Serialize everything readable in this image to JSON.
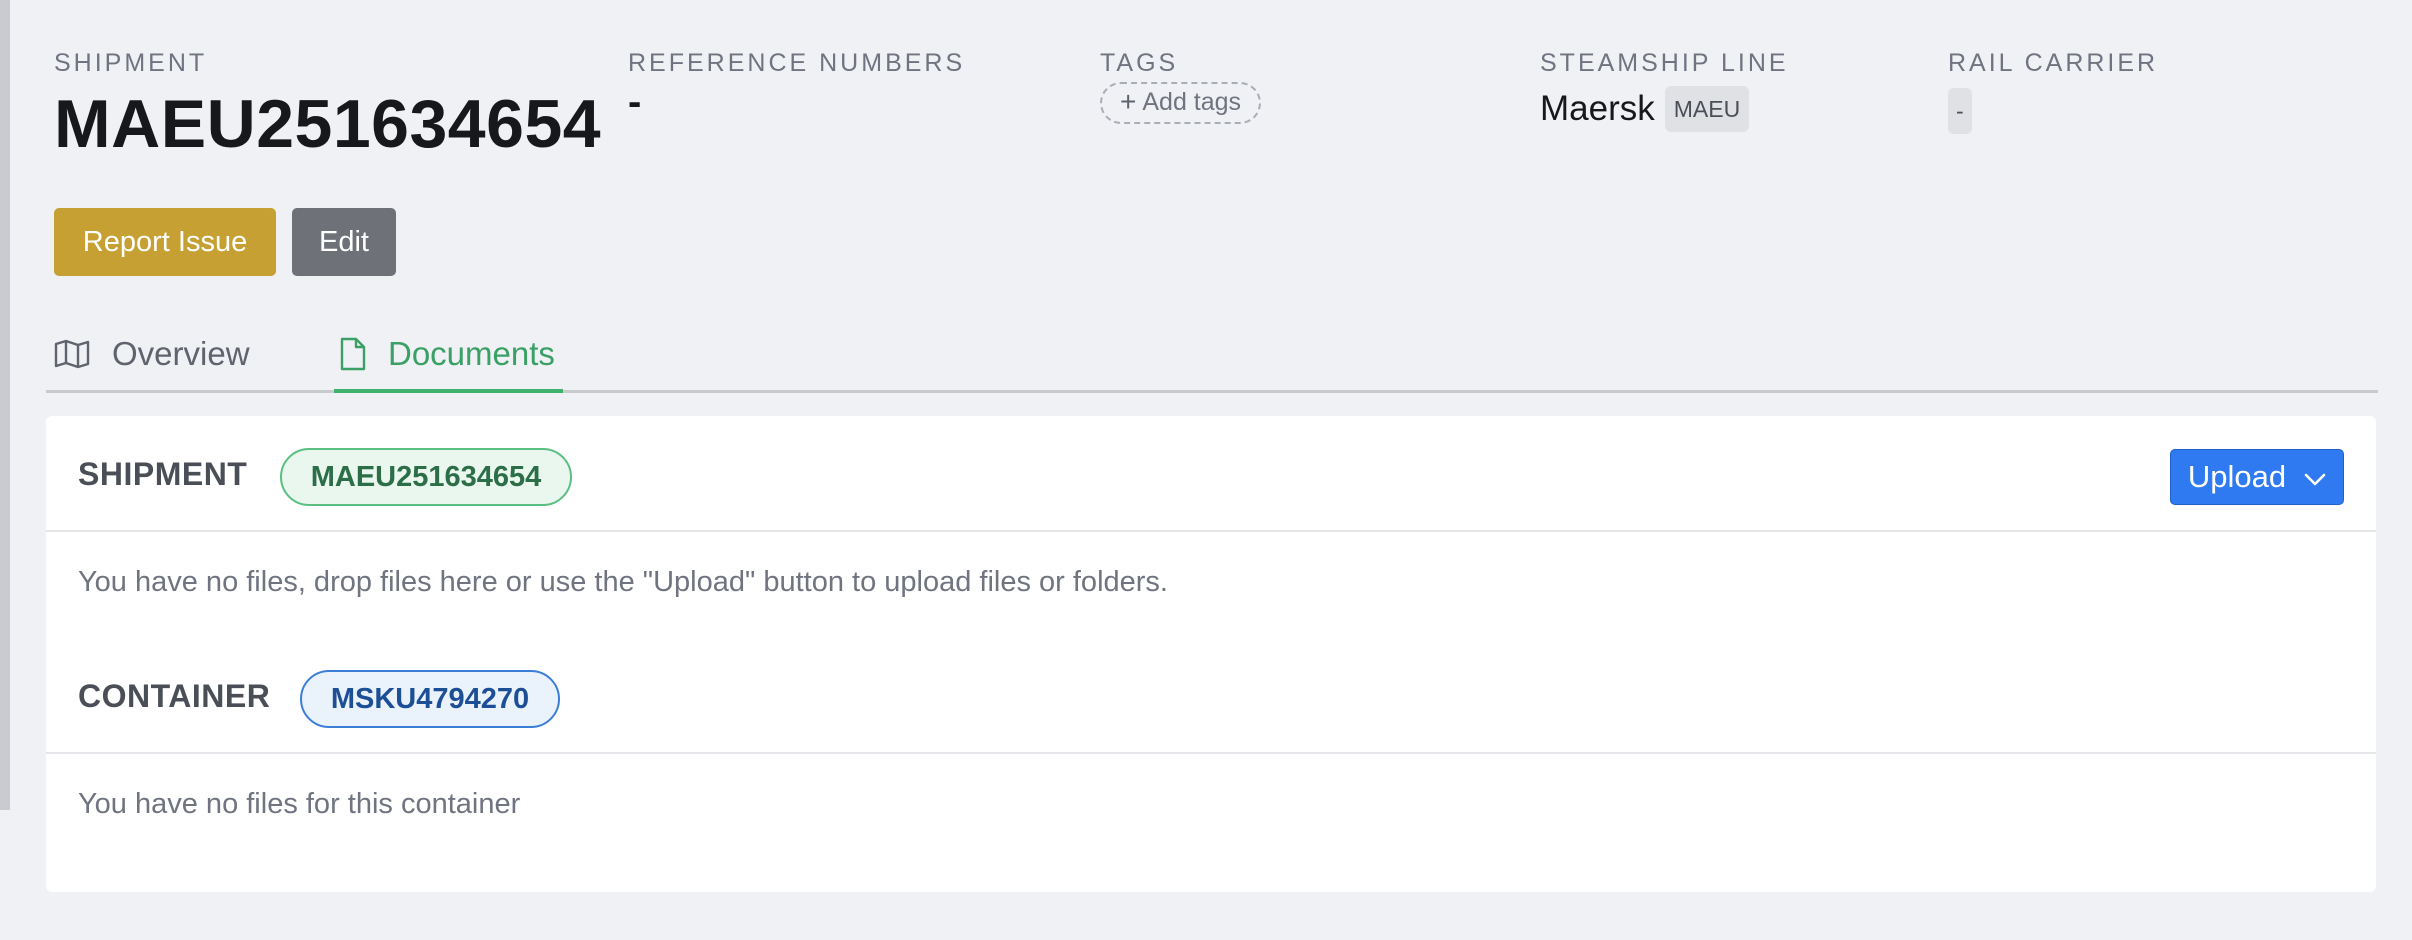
{
  "header": {
    "shipment": {
      "label": "SHIPMENT",
      "number": "MAEU251634654"
    },
    "reference_numbers": {
      "label": "REFERENCE NUMBERS",
      "value": "-"
    },
    "tags": {
      "label": "TAGS",
      "add_label": "Add tags"
    },
    "steamship_line": {
      "label": "STEAMSHIP LINE",
      "name": "Maersk",
      "scac": "MAEU"
    },
    "rail_carrier": {
      "label": "RAIL CARRIER",
      "value": "-"
    }
  },
  "actions": {
    "report_issue": "Report Issue",
    "edit": "Edit"
  },
  "tabs": [
    {
      "label": "Overview",
      "icon": "map-icon",
      "active": false
    },
    {
      "label": "Documents",
      "icon": "document-icon",
      "active": true
    }
  ],
  "documents": {
    "upload_label": "Upload",
    "shipment_section": {
      "title": "SHIPMENT",
      "badge": "MAEU251634654",
      "empty_text": "You have no files, drop files here or use the \"Upload\" button to upload files or folders."
    },
    "container_section": {
      "title": "CONTAINER",
      "badge": "MSKU4794270",
      "empty_text": "You have no files for this container"
    }
  },
  "colors": {
    "background": "#f0f1f5",
    "report_issue": "#c6a032",
    "edit": "#6e7278",
    "active_tab": "#3aa066",
    "upload": "#2f7af0",
    "shipment_badge_border": "#5bbf82",
    "container_badge_border": "#3b7ed8"
  }
}
